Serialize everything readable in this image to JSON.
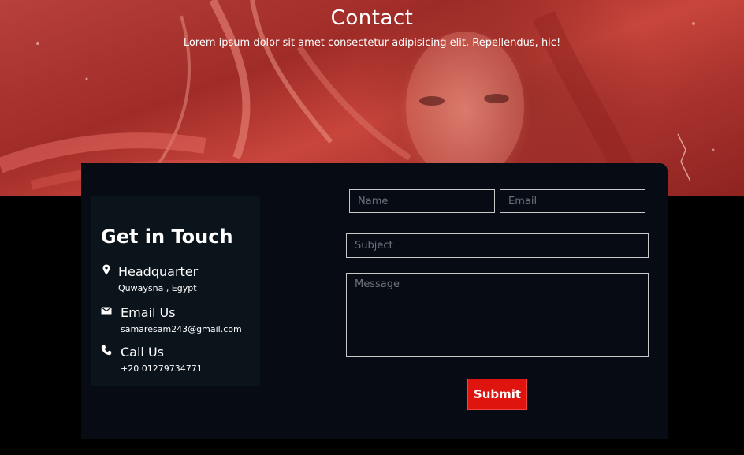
{
  "hero": {
    "title": "Contact",
    "subtitle": "Lorem ipsum dolor sit amet consectetur adipisicing elit. Repellendus, hic!"
  },
  "contact_info": {
    "title": "Get in Touch",
    "items": [
      {
        "icon": "location-pin-icon",
        "label": "Headquarter",
        "value": "Quwaysna , Egypt"
      },
      {
        "icon": "envelope-icon",
        "label": "Email Us",
        "value": "samaresam243@gmail.com"
      },
      {
        "icon": "phone-icon",
        "label": "Call Us",
        "value": "+20 01279734771"
      }
    ]
  },
  "form": {
    "name_placeholder": "Name",
    "email_placeholder": "Email",
    "subject_placeholder": "Subject",
    "message_placeholder": "Message",
    "submit_label": "Submit"
  },
  "colors": {
    "hero_overlay": "#b7403a",
    "card_background": "#070b14",
    "info_panel_background": "#0b131b",
    "submit_button": "#e0140f"
  }
}
